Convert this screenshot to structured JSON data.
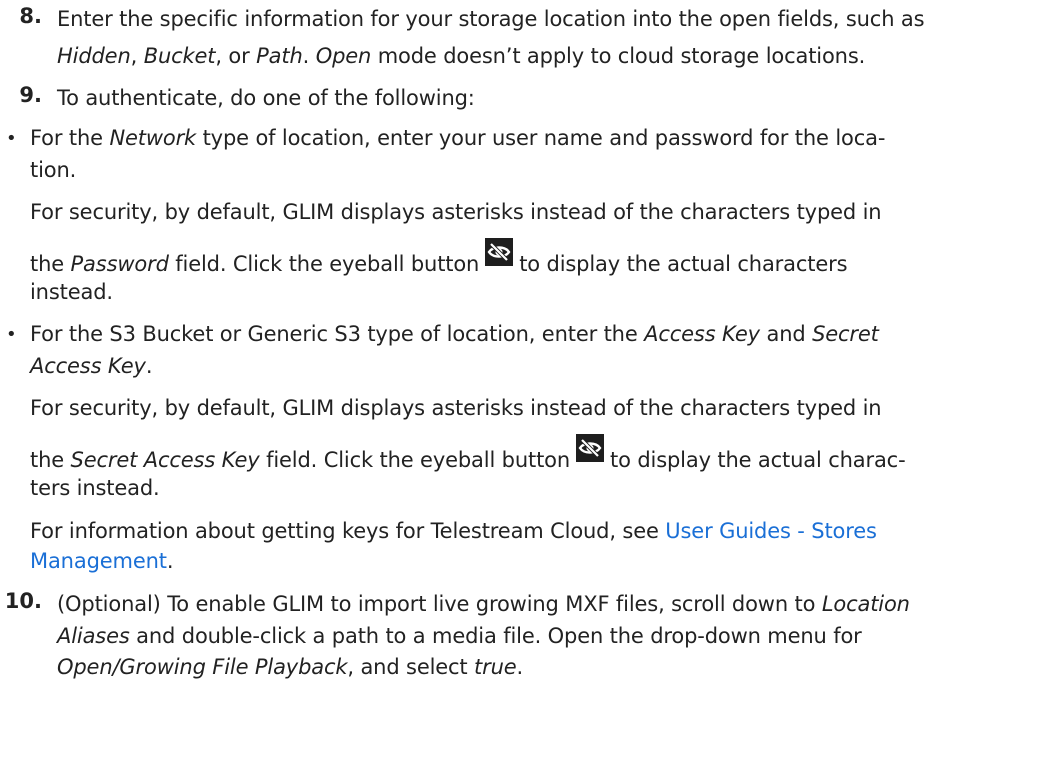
{
  "step8": {
    "number": "8.",
    "line1": "Enter the specific information for your storage location into the open fields, such as",
    "line2_a": "Hidden",
    "line2_b": ", ",
    "line2_c": "Bucket",
    "line2_d": ", or ",
    "line2_e": "Path",
    "line2_f": ". ",
    "line2_g": "Open",
    "line2_h": " mode doesn’t apply to cloud storage locations."
  },
  "step9": {
    "number": "9.",
    "text": "To authenticate, do one of the following:"
  },
  "bullet1": {
    "glyph": "•",
    "a": "For the ",
    "b": "Network",
    "c": " type of location, enter your user name and password for the loca-",
    "line2": "tion.",
    "sec1": "For security, by default, GLIM displays asterisks instead of the characters typed in",
    "sec2_a": "the ",
    "sec2_b": "Password",
    "sec2_c": " field. Click the eyeball button",
    "sec2_d": "to display the actual characters",
    "sec3": "instead."
  },
  "bullet2": {
    "glyph": "•",
    "a": "For the S3 Bucket or Generic S3 type of location, enter the ",
    "b": "Access Key",
    "c": " and ",
    "d": "Secret",
    "line2": "Access Key",
    "line2_end": ".",
    "sec1": "For security, by default, GLIM displays asterisks instead of the characters typed in",
    "sec2_a": "the ",
    "sec2_b": "Secret Access Key",
    "sec2_c": " field. Click the eyeball button",
    "sec2_d": "to display the actual charac-",
    "sec3": "ters instead.",
    "info1_a": "For information about getting keys for Telestream Cloud, see ",
    "info1_link": "User Guides - Stores",
    "info2_link": "Management",
    "info2_end": "."
  },
  "step10": {
    "number": "10.",
    "line1_a": "(Optional) To enable GLIM to import live growing MXF files, scroll down to ",
    "line1_b": "Location",
    "line2_a": "Aliases",
    "line2_b": " and double-click a path to a media file. Open the drop-down menu for",
    "line3_a": "Open/Growing File Playback",
    "line3_b": ", and select ",
    "line3_c": "true",
    "line3_d": "."
  },
  "colors": {
    "text": "#222222",
    "link": "#1a6fd6",
    "icon_bg": "#1e1e1e"
  },
  "icons": {
    "eyeball": "eye-slash-icon"
  }
}
